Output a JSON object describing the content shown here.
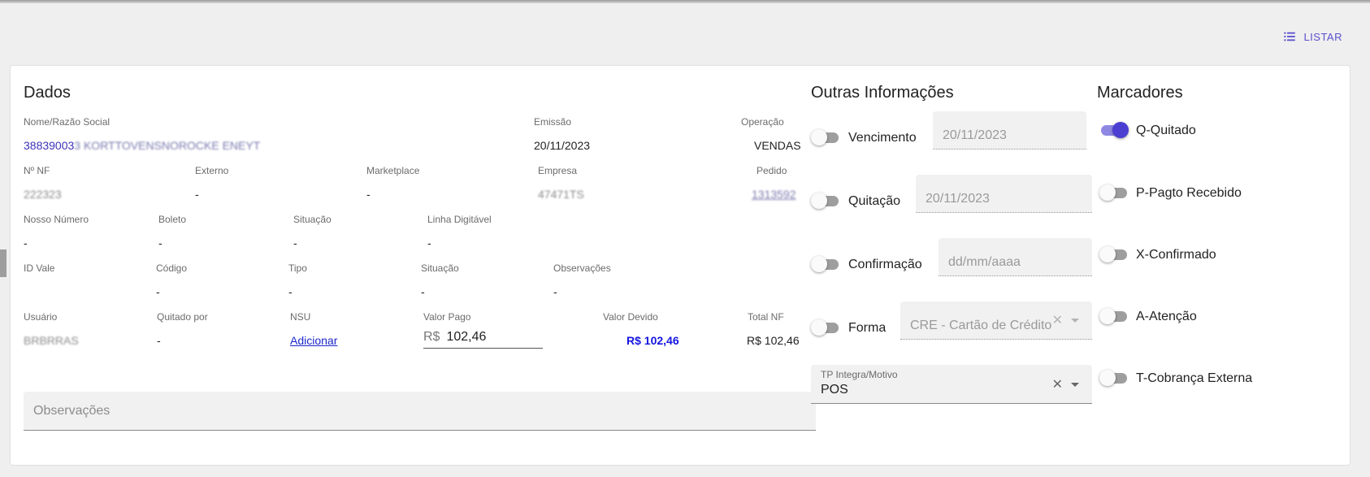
{
  "toolbar": {
    "listar_label": "LISTAR",
    "listar_icon": "list-icon"
  },
  "dados": {
    "title": "Dados",
    "row1": {
      "nome_label": "Nome/Razão Social",
      "nome_value": "38839003 3 KORTTOVENSNOROCKE ENEYT",
      "emissao_label": "Emissão",
      "emissao_value": "20/11/2023",
      "operacao_label": "Operação",
      "operacao_value": "VENDAS"
    },
    "row2": {
      "nf_label": "Nº NF",
      "nf_value": "222323",
      "externo_label": "Externo",
      "externo_value": "-",
      "marketplace_label": "Marketplace",
      "marketplace_value": "-",
      "empresa_label": "Empresa",
      "empresa_value": "47471TS",
      "pedido_label": "Pedido",
      "pedido_value": "1313592"
    },
    "row3": {
      "nosso_label": "Nosso Número",
      "nosso_value": "-",
      "boleto_label": "Boleto",
      "boleto_value": "-",
      "situacao_label": "Situação",
      "situacao_value": "-",
      "linha_label": "Linha Digitável",
      "linha_value": "-"
    },
    "row4": {
      "idvale_label": "ID Vale",
      "codigo_label": "Código",
      "codigo_value": "-",
      "tipo_label": "Tipo",
      "tipo_value": "-",
      "situacao_label": "Situação",
      "situacao_value": "-",
      "obs_label": "Observações",
      "obs_value": "-"
    },
    "row5": {
      "usuario_label": "Usuário",
      "usuario_value": "BRBRRAS",
      "quitado_label": "Quitado por",
      "quitado_value": "-",
      "nsu_label": "NSU",
      "nsu_link": "Adicionar",
      "valor_pago_label": "Valor Pago",
      "valor_pago_prefix": "R$",
      "valor_pago_value": "102,46",
      "valor_devido_label": "Valor Devido",
      "valor_devido_value": "R$ 102,46",
      "total_nf_label": "Total NF",
      "total_nf_value": "R$ 102,46"
    },
    "observacoes_placeholder": "Observações"
  },
  "outras": {
    "title": "Outras Informações",
    "vencimento": {
      "label": "Vencimento",
      "value": "20/11/2023",
      "enabled": false
    },
    "quitacao": {
      "label": "Quitação",
      "value": "20/11/2023",
      "enabled": false
    },
    "confirmacao": {
      "label": "Confirmação",
      "placeholder": "dd/mm/aaaa",
      "enabled": false
    },
    "forma": {
      "label": "Forma",
      "value": "CRE - Cartão de Crédito",
      "enabled": false
    },
    "tp_integra": {
      "label": "TP Integra/Motivo",
      "value": "POS"
    }
  },
  "marcadores": {
    "title": "Marcadores",
    "items": [
      {
        "label": "Q-Quitado",
        "on": true
      },
      {
        "label": "P-Pagto Recebido",
        "on": false
      },
      {
        "label": "X-Confirmado",
        "on": false
      },
      {
        "label": "A-Atenção",
        "on": false
      },
      {
        "label": "T-Cobrança Externa",
        "on": false
      }
    ]
  },
  "colors": {
    "accent": "#4b3fd1",
    "link": "#1a27c9",
    "valor_devido": "#1414e0"
  }
}
